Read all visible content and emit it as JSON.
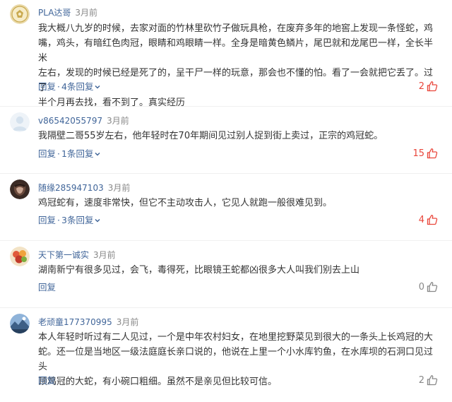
{
  "comments": [
    {
      "username": "PLA达哥",
      "time": "3月前",
      "lines": [
        "我大概八九岁的时候，去家对面的竹林里砍竹子做玩具枪，在废弃多年的地窖上发现一条怪蛇，鸡",
        "嘴，鸡头，有暗红色肉冠，眼睛和鸡眼睛一样。全身是暗黄色鳞片，尾巴就和龙尾巴一样，全长半米",
        "左右，发现的时候已经是死了的，呈干尸一样的玩意，那会也不懂的怕。看了一会就把它丢了。过了",
        "半个月再去找，看不到了。真实经历"
      ],
      "reply_label": "回复",
      "separator": "·",
      "more_replies": "4条回复",
      "likes": "2",
      "liked_color": "hot"
    },
    {
      "username": "v86542055797",
      "time": "3月前",
      "lines": [
        "我隔壁二哥55岁左右，他年轻时在70年期间见过别人捉到街上卖过，正宗的鸡冠蛇。"
      ],
      "reply_label": "回复",
      "separator": "·",
      "more_replies": "1条回复",
      "likes": "15",
      "liked_color": "hot"
    },
    {
      "username": "随缘285947103",
      "time": "3月前",
      "lines": [
        "鸡冠蛇有，速度非常快，但它不主动攻击人，它见人就跑一般很难见到。"
      ],
      "reply_label": "回复",
      "separator": "·",
      "more_replies": "3条回复",
      "likes": "4",
      "liked_color": "hot"
    },
    {
      "username": "天下第一诚实",
      "time": "3月前",
      "lines": [
        "湖南新宁有很多见过，会飞，毒得死，比眼镜王蛇都凶很多大人叫我们别去上山"
      ],
      "reply_label": "回复",
      "likes": "0",
      "liked_color": "cold"
    },
    {
      "username": "老顽童177370995",
      "time": "3月前",
      "lines": [
        "本人年轻时听过有二人见过，一个是中年农村妇女，在地里挖野菜见到很大的一条头上长鸡冠的大",
        "蛇。还一位是当地区一级法庭庭长亲口说的，他说在上里一个小水库钓鱼，在水库坝的石洞口见过头",
        "顶鸡冠的大蛇，有小碗口粗细。虽然不是亲见但比较可信。"
      ],
      "reply_label": "回复",
      "likes": "2",
      "liked_color": "cold"
    }
  ],
  "colors": {
    "link": "#406599",
    "hot": "#e9463b",
    "muted": "#888888",
    "text": "#333333"
  },
  "icons": {
    "like": "thumb-up-icon",
    "expand": "chevron-down-icon"
  }
}
